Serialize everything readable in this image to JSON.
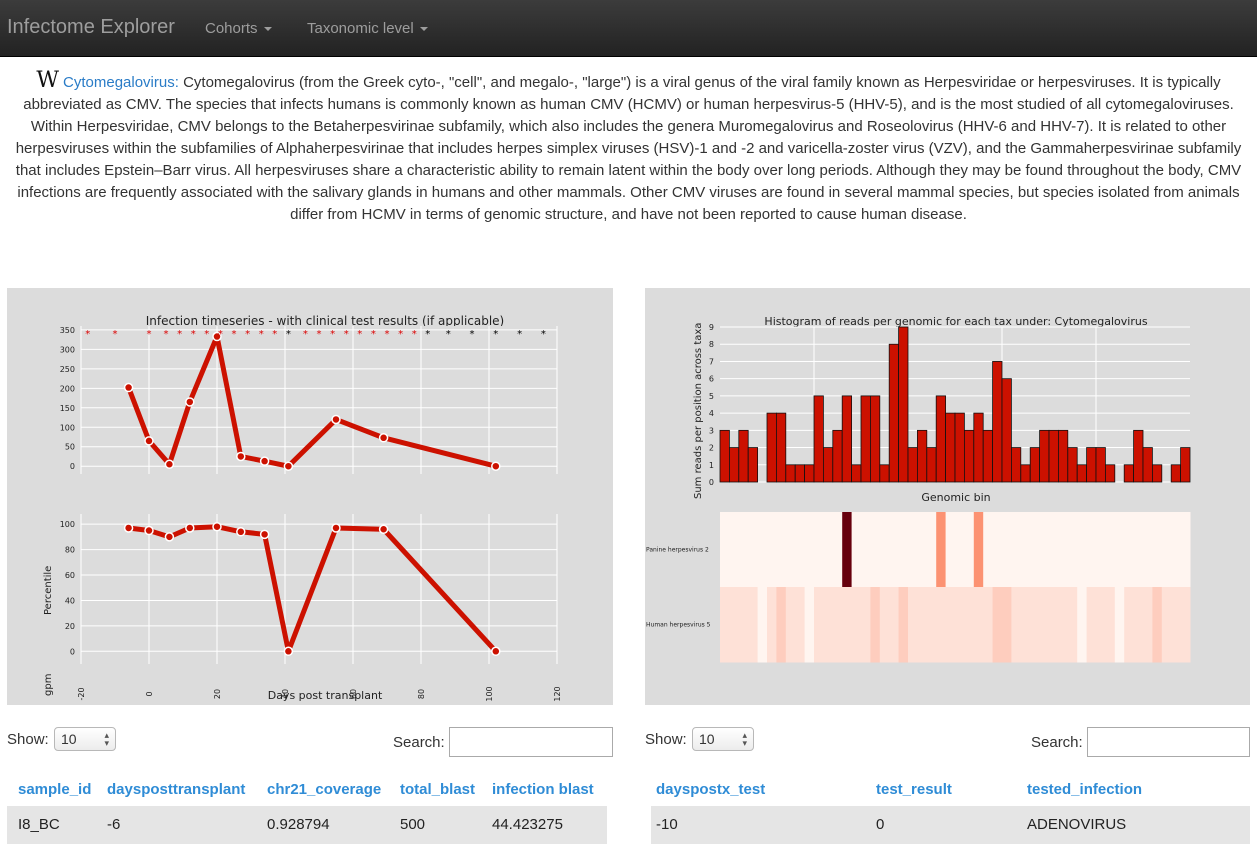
{
  "nav": {
    "brand": "Infectome Explorer",
    "menu": [
      {
        "label": "Cohorts"
      },
      {
        "label": "Taxonomic level"
      }
    ]
  },
  "description": {
    "icon": "wikipedia-icon",
    "link": "Cytomegalovirus:",
    "text": " Cytomegalovirus (from the Greek cyto-, \"cell\", and megalo-, \"large\") is a viral genus of the viral family known as Herpesviridae or herpesviruses. It is typically abbreviated as CMV. The species that infects humans is commonly known as human CMV (HCMV) or human herpesvirus-5 (HHV-5), and is the most studied of all cytomegaloviruses. Within Herpesviridae, CMV belongs to the Betaherpesvirinae subfamily, which also includes the genera Muromegalovirus and Roseolovirus (HHV-6 and HHV-7). It is related to other herpesviruses within the subfamilies of Alphaherpesvirinae that includes herpes simplex viruses (HSV)-1 and -2 and varicella-zoster virus (VZV), and the Gammaherpesvirinae subfamily that includes Epstein–Barr virus. All herpesviruses share a characteristic ability to remain latent within the body over long periods. Although they may be found throughout the body, CMV infections are frequently associated with the salivary glands in humans and other mammals. Other CMV viruses are found in several mammal species, but species isolated from animals differ from HCMV in terms of genomic structure, and have not been reported to cause human disease."
  },
  "chart_data": [
    {
      "type": "line",
      "title": "Infection timeseries - with clinical test results (if applicable)",
      "xlabel": "Days post transplant",
      "ylabel": "gpm",
      "xlim": [
        -20,
        120
      ],
      "xticks": [
        "-20",
        "0",
        "20",
        "40",
        "60",
        "80",
        "100",
        "120"
      ],
      "ylim": [
        -20,
        360
      ],
      "yticks": [
        "0",
        "50",
        "100",
        "150",
        "200",
        "250",
        "300",
        "350"
      ],
      "x": [
        -6,
        0,
        6,
        12,
        20,
        27,
        34,
        41,
        55,
        69,
        102
      ],
      "y": [
        202,
        65,
        5,
        165,
        333,
        25,
        13,
        0,
        120,
        73,
        0
      ],
      "test_markers": [
        {
          "x": -18,
          "color": "#dd0000"
        },
        {
          "x": -10,
          "color": "#dd0000"
        },
        {
          "x": 0,
          "color": "#dd0000"
        },
        {
          "x": 5,
          "color": "#dd0000"
        },
        {
          "x": 9,
          "color": "#dd0000"
        },
        {
          "x": 13,
          "color": "#dd0000"
        },
        {
          "x": 17,
          "color": "#dd0000"
        },
        {
          "x": 21,
          "color": "#dd0000"
        },
        {
          "x": 25,
          "color": "#dd0000"
        },
        {
          "x": 29,
          "color": "#dd0000"
        },
        {
          "x": 33,
          "color": "#dd0000"
        },
        {
          "x": 37,
          "color": "#dd0000"
        },
        {
          "x": 41,
          "color": "#000000"
        },
        {
          "x": 46,
          "color": "#dd0000"
        },
        {
          "x": 50,
          "color": "#dd0000"
        },
        {
          "x": 54,
          "color": "#dd0000"
        },
        {
          "x": 58,
          "color": "#dd0000"
        },
        {
          "x": 62,
          "color": "#dd0000"
        },
        {
          "x": 66,
          "color": "#dd0000"
        },
        {
          "x": 70,
          "color": "#dd0000"
        },
        {
          "x": 74,
          "color": "#dd0000"
        },
        {
          "x": 78,
          "color": "#dd0000"
        },
        {
          "x": 82,
          "color": "#000000"
        },
        {
          "x": 88,
          "color": "#000000"
        },
        {
          "x": 95,
          "color": "#000000"
        },
        {
          "x": 102,
          "color": "#000000"
        },
        {
          "x": 109,
          "color": "#000000"
        },
        {
          "x": 116,
          "color": "#000000"
        }
      ],
      "line_color": "#cc1100"
    },
    {
      "type": "line",
      "xlabel": "Days post transplant",
      "ylabel": "Percentile",
      "xlim": [
        -20,
        120
      ],
      "xticks": [
        "-20",
        "0",
        "20",
        "40",
        "60",
        "80",
        "100",
        "120"
      ],
      "ylim": [
        -10,
        108
      ],
      "yticks": [
        "0",
        "20",
        "40",
        "60",
        "80",
        "100"
      ],
      "x": [
        -6,
        0,
        6,
        12,
        20,
        27,
        34,
        41,
        55,
        69,
        102
      ],
      "y": [
        97,
        95,
        90,
        97,
        98,
        94,
        92,
        0,
        97,
        96,
        0
      ],
      "line_color": "#cc1100"
    },
    {
      "type": "bar",
      "title": "Histogram of reads per genomic for each tax under: Cytomegalovirus",
      "xlabel": "Genomic bin",
      "ylabel": "Sum reads per position across taxa",
      "ylim": [
        0,
        9
      ],
      "yticks": [
        "0",
        "1",
        "2",
        "3",
        "4",
        "5",
        "6",
        "7",
        "8",
        "9"
      ],
      "values": [
        3,
        2,
        3,
        2,
        0,
        4,
        4,
        1,
        1,
        1,
        5,
        2,
        3,
        5,
        1,
        5,
        5,
        1,
        8,
        9,
        2,
        3,
        2,
        5,
        4,
        4,
        3,
        4,
        3,
        7,
        6,
        2,
        1,
        2,
        3,
        3,
        3,
        2,
        1,
        2,
        2,
        1,
        0,
        1,
        3,
        2,
        1,
        0,
        1,
        2
      ],
      "bar_color": "#cc1100"
    },
    {
      "type": "heatmap",
      "rows": [
        "Panine herpesvirus 2",
        "Human herpesvirus 5"
      ],
      "values": [
        [
          0,
          0,
          0,
          0,
          0,
          0,
          0,
          0,
          0,
          0,
          0,
          0,
          0,
          10,
          0,
          0,
          0,
          0,
          0,
          0,
          0,
          0,
          0,
          5,
          0,
          0,
          0,
          5,
          0,
          0,
          0,
          0,
          0,
          0,
          0,
          0,
          0,
          0,
          0,
          0,
          0,
          0,
          0,
          0,
          0,
          0,
          0,
          0,
          0,
          0
        ],
        [
          1,
          1,
          1,
          1,
          0,
          1,
          2,
          1,
          1,
          0,
          1,
          1,
          1,
          1,
          1,
          1,
          2,
          1,
          1,
          2,
          1,
          1,
          1,
          1,
          1,
          1,
          1,
          1,
          1,
          2,
          2,
          1,
          1,
          1,
          1,
          1,
          1,
          1,
          0,
          1,
          1,
          1,
          0,
          1,
          1,
          1,
          2,
          1,
          1,
          1
        ]
      ]
    }
  ],
  "left_table": {
    "show_label": "Show:",
    "show_value": "10",
    "search_label": "Search:",
    "search_value": "",
    "columns": [
      "sample_id",
      "daysposttransplant",
      "chr21_coverage",
      "total_blast",
      "infection blast"
    ],
    "rows": [
      [
        "I8_BC",
        "-6",
        "0.928794",
        "500",
        "44.423275"
      ]
    ]
  },
  "right_table": {
    "show_label": "Show:",
    "show_value": "10",
    "search_label": "Search:",
    "search_value": "",
    "columns": [
      "dayspostx_test",
      "test_result",
      "tested_infection"
    ],
    "rows": [
      [
        "-10",
        "0",
        "ADENOVIRUS"
      ]
    ]
  }
}
